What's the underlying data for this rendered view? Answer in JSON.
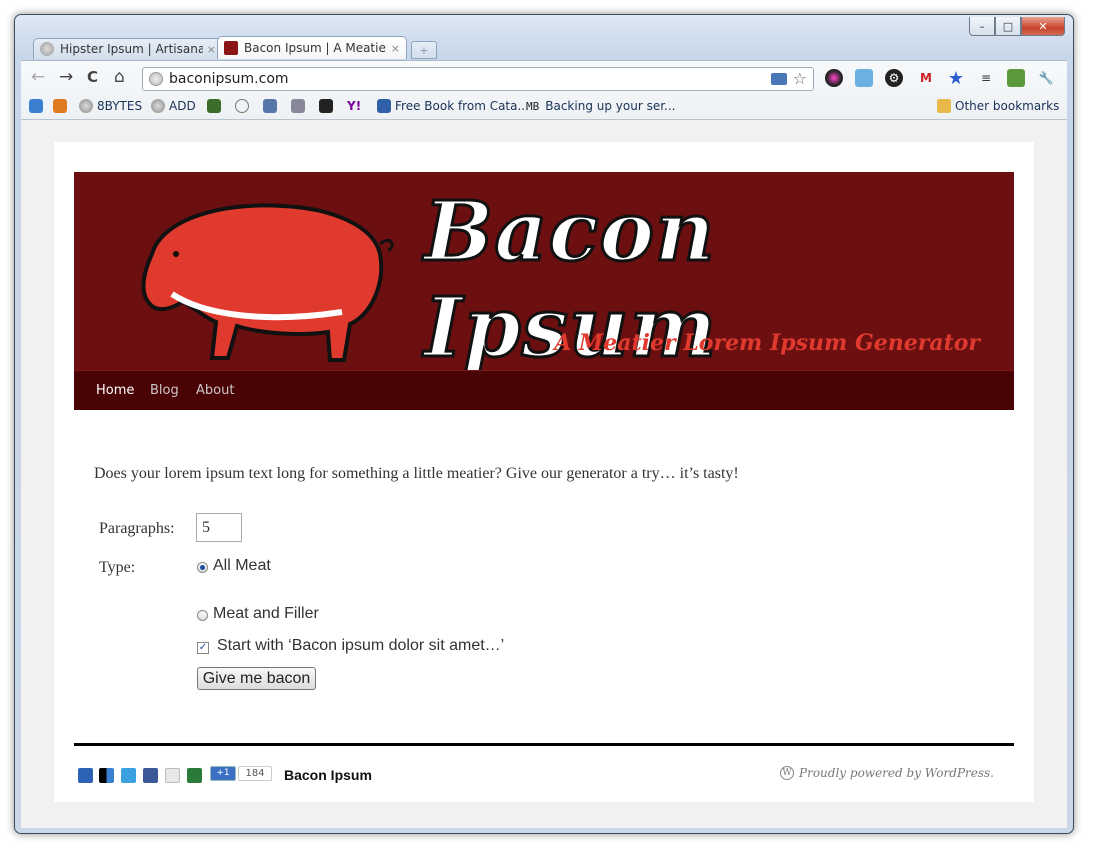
{
  "window": {
    "controls": {
      "minimize": "–",
      "maximize": "□",
      "close": "✕"
    }
  },
  "tabs": [
    {
      "title": "Hipster Ipsum | Artisanal fill",
      "close": "×",
      "active": false
    },
    {
      "title": "Bacon Ipsum | A Meatier Lo",
      "close": "×",
      "active": true
    }
  ],
  "toolbar": {
    "back": "←",
    "forward": "→",
    "reload": "C",
    "home": "⌂",
    "url": "baconipsum.com",
    "star": "☆",
    "wrench": "🔧"
  },
  "bookmarks": {
    "items": [
      "8BYTES",
      "ADD",
      "Free Book from Cata...",
      "MB",
      "Backing up your ser..."
    ],
    "other": "Other bookmarks"
  },
  "site": {
    "title": "Bacon Ipsum",
    "tagline": "A Meatier Lorem Ipsum Generator",
    "menu": [
      "Home",
      "Blog",
      "About"
    ],
    "intro": "Does your lorem ipsum text long for something a little meatier? Give our generator a try… it’s tasty!",
    "form": {
      "paragraphs_label": "Paragraphs:",
      "paragraphs_value": "5",
      "type_label": "Type:",
      "option_all_meat": "All Meat",
      "option_meat_filler": "Meat and Filler",
      "start_with": "Start with ‘Bacon ipsum dolor sit amet…’",
      "submit": "Give me bacon"
    },
    "footer": {
      "plus_one": "+1",
      "plus_count": "184",
      "site_name": "Bacon Ipsum",
      "powered": "Proudly powered by WordPress."
    }
  },
  "colors": {
    "banner": "#6b0f11",
    "menu": "#4a0304",
    "pig": "#e03a2e",
    "tagline": "#e03a2e"
  }
}
